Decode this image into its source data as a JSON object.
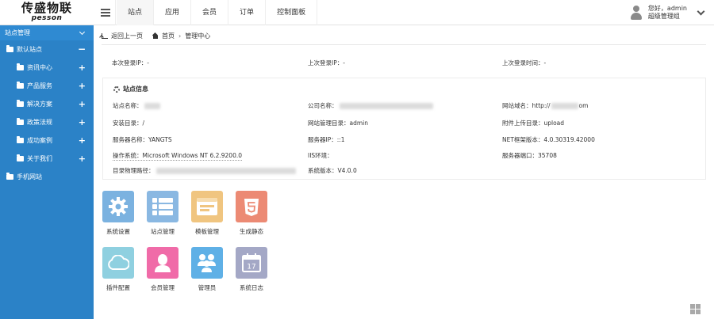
{
  "logo": {
    "cn": "传盛物联",
    "en": "pesson"
  },
  "top_tabs": [
    "站点",
    "应用",
    "会员",
    "订单",
    "控制面板"
  ],
  "user": {
    "greeting": "您好，admin",
    "role": "超级管理组"
  },
  "sidebar": {
    "header": "站点管理",
    "site": "默认站点",
    "items": [
      "资讯中心",
      "产品服务",
      "解决方案",
      "政策法规",
      "成功案例",
      "关于我们"
    ],
    "other": "手机网站"
  },
  "breadcrumb": {
    "back": "返回上一页",
    "home": "首页",
    "current": "管理中心"
  },
  "login": {
    "last_ip_label": "本次登录IP：-",
    "prev_ip_label": "上次登录IP：-",
    "prev_time_label": "上次登录时间：-"
  },
  "site_info": {
    "title": "站点信息",
    "site_name": "站点名称：",
    "company": "公司名称：",
    "domain_prefix": "网站域名：http://",
    "domain_suffix": "om",
    "install_dir": "安装目录：/",
    "admin_dir": "网站管理目录：admin",
    "upload_dir": "附件上传目录：upload",
    "server_name": "服务器名称：YANGTS",
    "server_ip": "服务器IP：::1",
    "net_version": "NET框架版本：4.0.30319.42000",
    "os": "操作系统：Microsoft Windows NT 6.2.9200.0",
    "iis": "IIS环境：",
    "port": "服务器端口：35708",
    "phys_path": "目录物理路径：",
    "sys_version": "系统版本：V4.0.0"
  },
  "tiles": [
    {
      "label": "系统设置",
      "color": "#7bb2e0",
      "icon": "gear-icon"
    },
    {
      "label": "站点管理",
      "color": "#8ab8e2",
      "icon": "list-icon"
    },
    {
      "label": "模板管理",
      "color": "#f0c580",
      "icon": "template-icon"
    },
    {
      "label": "生成静态",
      "color": "#ec8a74",
      "icon": "html5-icon"
    },
    {
      "label": "插件配置",
      "color": "#8fd0e0",
      "icon": "cloud-icon"
    },
    {
      "label": "会员管理",
      "color": "#f06ba8",
      "icon": "user-icon"
    },
    {
      "label": "管理员",
      "color": "#5fb0e6",
      "icon": "users-icon"
    },
    {
      "label": "系统日志",
      "color": "#a4a8c6",
      "icon": "calendar-icon"
    }
  ],
  "calendar_day": "17"
}
